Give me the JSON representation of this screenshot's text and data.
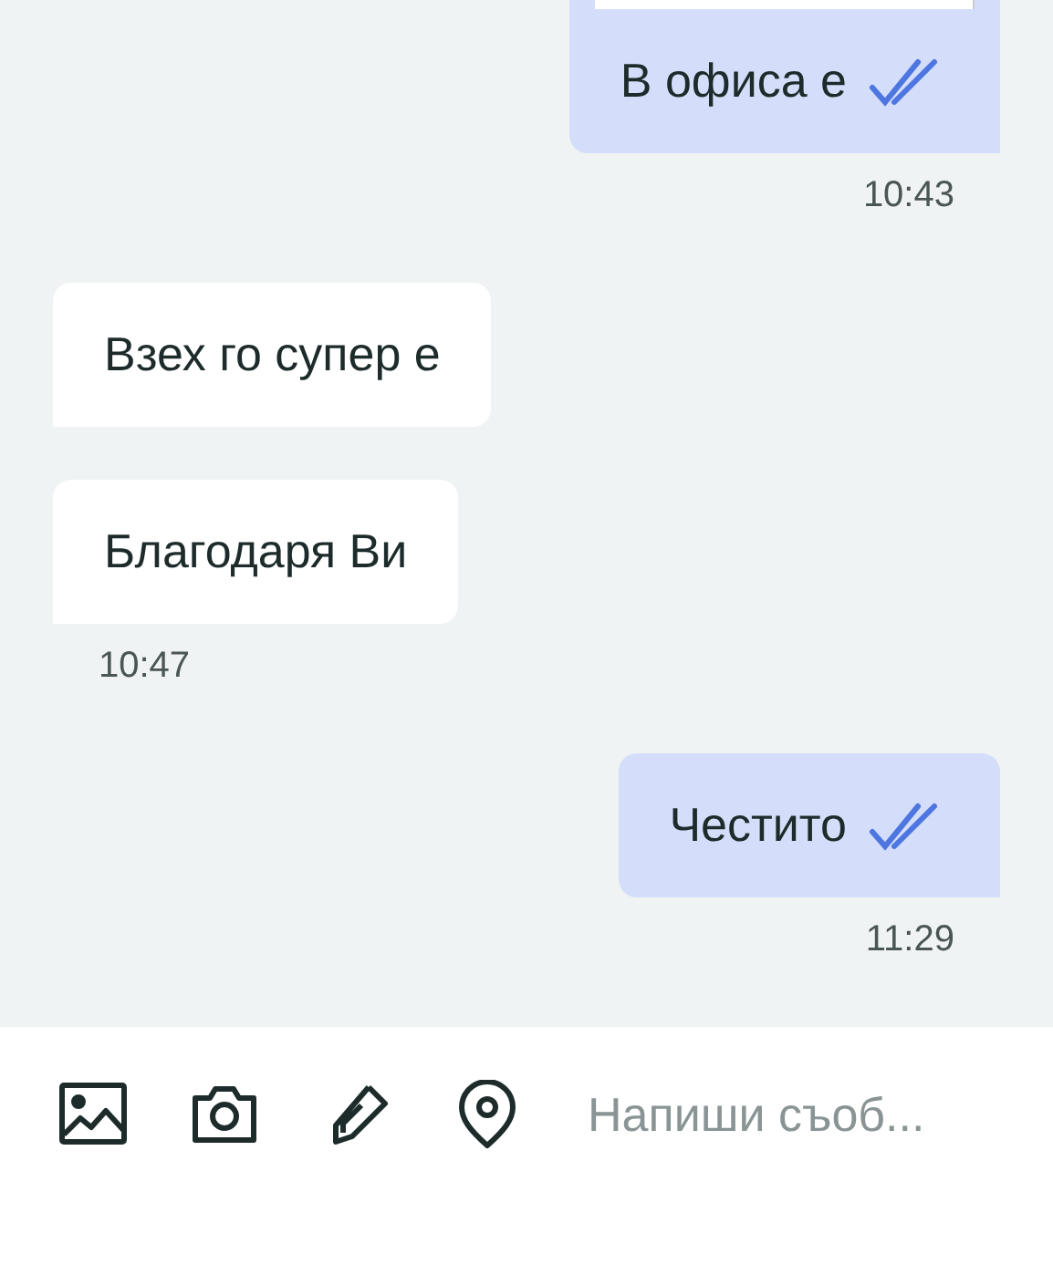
{
  "messages": [
    {
      "kind": "out",
      "text": "В офиса е",
      "read": true,
      "has_preview": true,
      "time": "10:43"
    },
    {
      "kind": "in",
      "text": "Взех го супер е"
    },
    {
      "kind": "in",
      "text": "Благодаря Ви",
      "time": "10:47"
    },
    {
      "kind": "out",
      "text": "Честито",
      "read": true,
      "time": "11:29"
    }
  ],
  "composer": {
    "placeholder": "Напиши съоб..."
  }
}
